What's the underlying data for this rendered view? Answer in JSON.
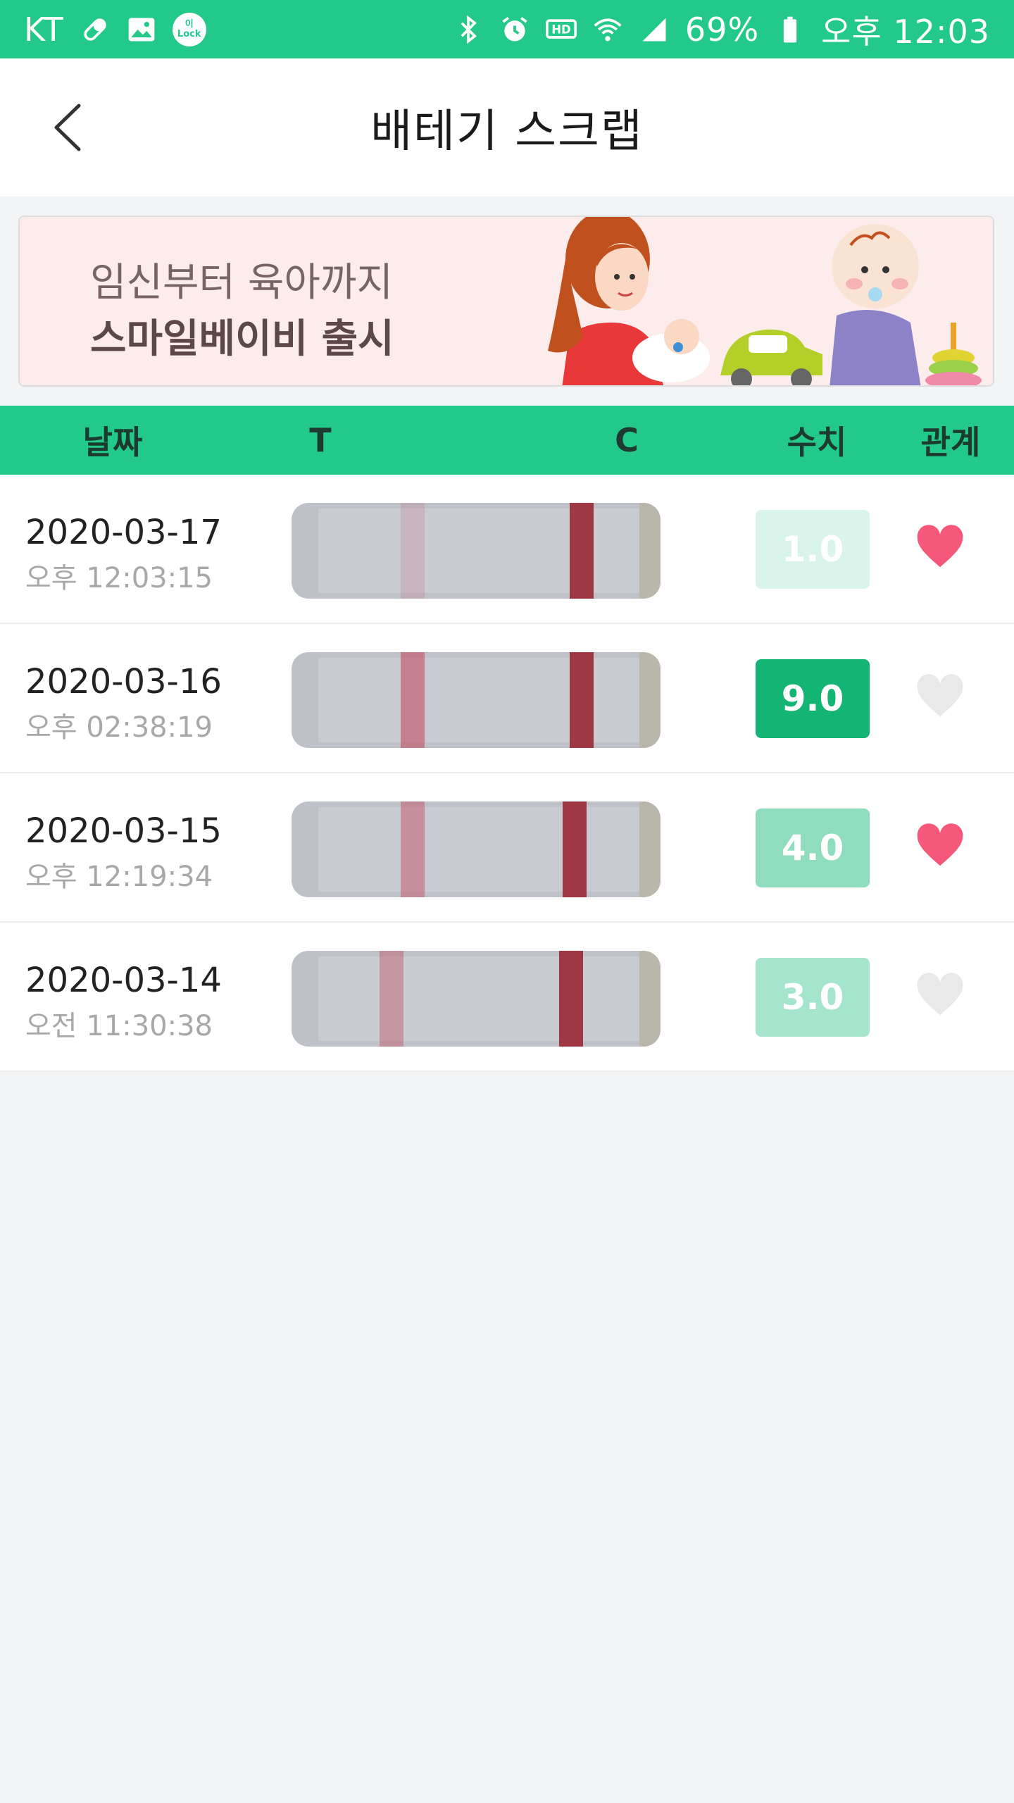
{
  "status_bar": {
    "carrier": "KT",
    "battery_text": "69%",
    "time": "오후 12:03",
    "lock_label": "이 Lock",
    "icons": [
      "pill-icon",
      "image-icon",
      "lock-app-icon",
      "bluetooth-icon",
      "alarm-icon",
      "hd-icon",
      "wifi-icon",
      "signal-icon",
      "battery-icon"
    ]
  },
  "header": {
    "title": "배테기 스크랩",
    "back_icon": "back-chevron-icon"
  },
  "banner": {
    "line1": "임신부터 육아까지",
    "line2": "스마일베이비 출시"
  },
  "table": {
    "columns": [
      "날짜",
      "T",
      "C",
      "수치",
      "관계"
    ],
    "rows": [
      {
        "date": "2020-03-17",
        "time": "오후 12:03:15",
        "value": "1.0",
        "value_color": "#d9f4ea",
        "t_intensity": 0.15,
        "relation": true
      },
      {
        "date": "2020-03-16",
        "time": "오후 02:38:19",
        "value": "9.0",
        "value_color": "#13b474",
        "t_intensity": 0.55,
        "relation": false
      },
      {
        "date": "2020-03-15",
        "time": "오후 12:19:34",
        "value": "4.0",
        "value_color": "#8fdcbf",
        "t_intensity": 0.45,
        "relation": true
      },
      {
        "date": "2020-03-14",
        "time": "오전 11:30:38",
        "value": "3.0",
        "value_color": "#a5e4cd",
        "t_intensity": 0.4,
        "relation": false
      }
    ]
  },
  "colors": {
    "accent": "#22c98a",
    "heart_active": "#f5587a",
    "heart_inactive": "#e9e9e9"
  }
}
